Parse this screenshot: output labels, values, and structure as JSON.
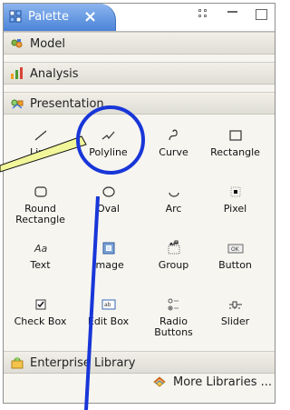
{
  "window": {
    "title": "Palette"
  },
  "sections": {
    "model": "Model",
    "analysis": "Analysis",
    "presentation": "Presentation",
    "enterprise": "Enterprise Library"
  },
  "items": [
    {
      "label": "Line"
    },
    {
      "label": "Polyline"
    },
    {
      "label": "Curve"
    },
    {
      "label": "Rectangle"
    },
    {
      "label": "Round Rectangle"
    },
    {
      "label": "Oval"
    },
    {
      "label": "Arc"
    },
    {
      "label": "Pixel"
    },
    {
      "label": "Text"
    },
    {
      "label": "Image"
    },
    {
      "label": "Group"
    },
    {
      "label": "Button"
    },
    {
      "label": "Check Box"
    },
    {
      "label": "Edit Box"
    },
    {
      "label": "Radio Buttons"
    },
    {
      "label": "Slider"
    }
  ],
  "footer": {
    "more_libraries": "More Libraries ..."
  }
}
